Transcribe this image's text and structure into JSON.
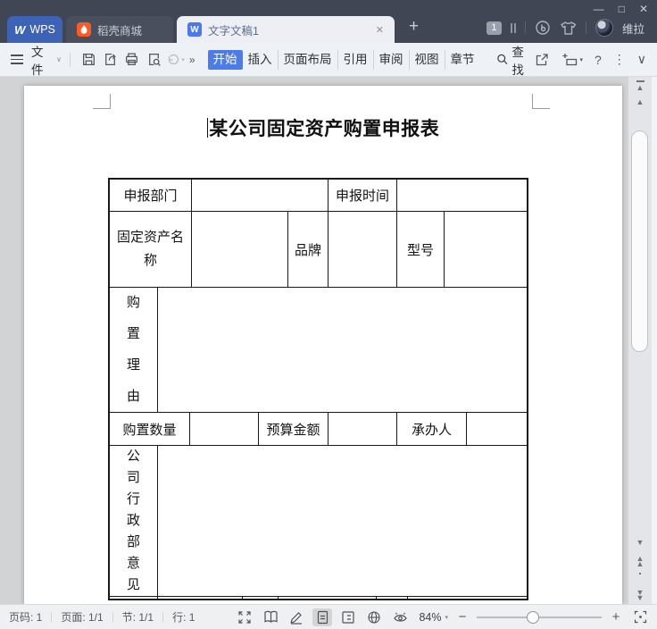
{
  "colors": {
    "accent_blue": "#4c7ce8",
    "wps_tab_blue": "#3c63b5",
    "flame_orange": "#ff5a22",
    "doc_icon_blue": "#4a78ee",
    "titlebar_bg": "#414654",
    "canvas_gray": "#d2d3d5"
  },
  "titlebar": {
    "wps_tab": {
      "logo_letter": "W",
      "label": "WPS"
    },
    "store_tab": {
      "label": "稻壳商城"
    },
    "doc_tab": {
      "icon_letter": "W",
      "label": "文字文稿1",
      "close": "✕"
    },
    "new_tab": "+",
    "badge": "1",
    "username": "维拉",
    "window": {
      "minimize": "—",
      "maximize": "□",
      "close": "✕"
    }
  },
  "toolbar": {
    "file": "文件",
    "file_chevron": "∨",
    "undo_chevron": "▾",
    "more": "»",
    "tabs": [
      {
        "label": "开始"
      },
      {
        "label": "插入"
      },
      {
        "label": "页面布局"
      },
      {
        "label": "引用"
      },
      {
        "label": "审阅"
      },
      {
        "label": "视图"
      },
      {
        "label": "章节"
      }
    ],
    "search": "查找",
    "new_window_chevron": "▾",
    "help": "?",
    "overflow": "⋮",
    "collapse": "∨"
  },
  "document": {
    "title": "某公司固定资产购置申报表",
    "table": {
      "rows": [
        {
          "cells": [
            "申报部门",
            "",
            "申报时间",
            ""
          ]
        },
        {
          "cells": [
            "固定资产名称",
            "",
            "品牌",
            "",
            "型号",
            ""
          ]
        },
        {
          "cells": [
            "购置理由",
            ""
          ]
        },
        {
          "cells": [
            "购置数量",
            "",
            "预算金额",
            "",
            "承办人",
            ""
          ]
        },
        {
          "cells": [
            "公司行政部意见",
            ""
          ]
        },
        {
          "cells": [
            "",
            "",
            "",
            "",
            "",
            ""
          ]
        }
      ]
    }
  },
  "scrollbar": {
    "up": "▲",
    "down": "▼"
  },
  "statusbar": {
    "page_number": "页码: 1",
    "page_view": "页面: 1/1",
    "section": "节: 1/1",
    "line": "行: 1",
    "zoom": "84%",
    "zoom_chevron": "▾",
    "zoom_out": "−",
    "zoom_in": "+"
  }
}
